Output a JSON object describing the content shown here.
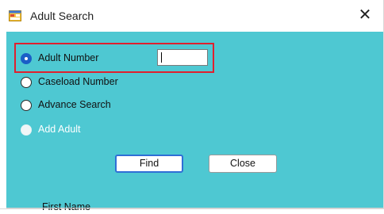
{
  "window": {
    "title": "Adult Search",
    "close_glyph": "✕",
    "app_icon": "form-window-icon"
  },
  "options": [
    {
      "label": "Adult Number",
      "checked": true,
      "enabled": true
    },
    {
      "label": "Caseload Number",
      "checked": false,
      "enabled": true
    },
    {
      "label": "Advance Search",
      "checked": false,
      "enabled": true
    },
    {
      "label": "Add Adult",
      "checked": false,
      "enabled": false
    }
  ],
  "adult_number_input": {
    "value": ""
  },
  "buttons": {
    "find": "Find",
    "close": "Close"
  },
  "partial_field_label": "First Name",
  "colors": {
    "client_background": "#4ec8d2",
    "highlight": "#e0202e",
    "radio_checked": "#1a5fc7"
  }
}
